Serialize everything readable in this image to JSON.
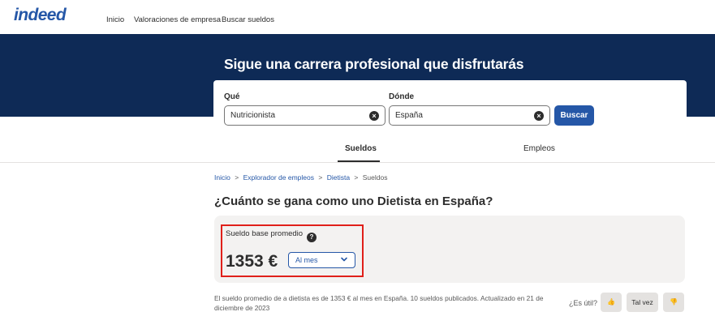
{
  "nav": {
    "logo": "indeed",
    "links": [
      "Inicio",
      "Valoraciones de empresa",
      "Buscar sueldos"
    ]
  },
  "hero": {
    "title": "Sigue una carrera profesional que disfrutarás"
  },
  "search": {
    "what_label": "Qué",
    "what_value": "Nutricionista",
    "where_label": "Dónde",
    "where_value": "España",
    "clear_glyph": "×",
    "button_label": "Buscar"
  },
  "tabs": [
    {
      "label": "Sueldos",
      "active": true
    },
    {
      "label": "Empleos",
      "active": false
    }
  ],
  "breadcrumb": {
    "items": [
      "Inicio",
      "Explorador de empleos",
      "Dietista",
      "Sueldos"
    ],
    "separator": ">"
  },
  "page_title": "¿Cuánto se gana como uno Dietista en España?",
  "salary": {
    "label": "Sueldo base promedio",
    "help_glyph": "?",
    "amount": "1353 €",
    "period": "Al mes"
  },
  "note": "El sueldo promedio de a dietista es de 1353 € al mes en España.  10 sueldos publicados. Actualizado en 21 de diciembre de 2023",
  "feedback": {
    "question": "¿Es útil?",
    "thumbs_up_glyph": "👍",
    "maybe_label": "Tal vez",
    "thumbs_down_glyph": "👎"
  },
  "colors": {
    "brand_blue": "#2557a7",
    "hero_navy": "#0e2a56",
    "highlight_red": "#e0201a"
  }
}
